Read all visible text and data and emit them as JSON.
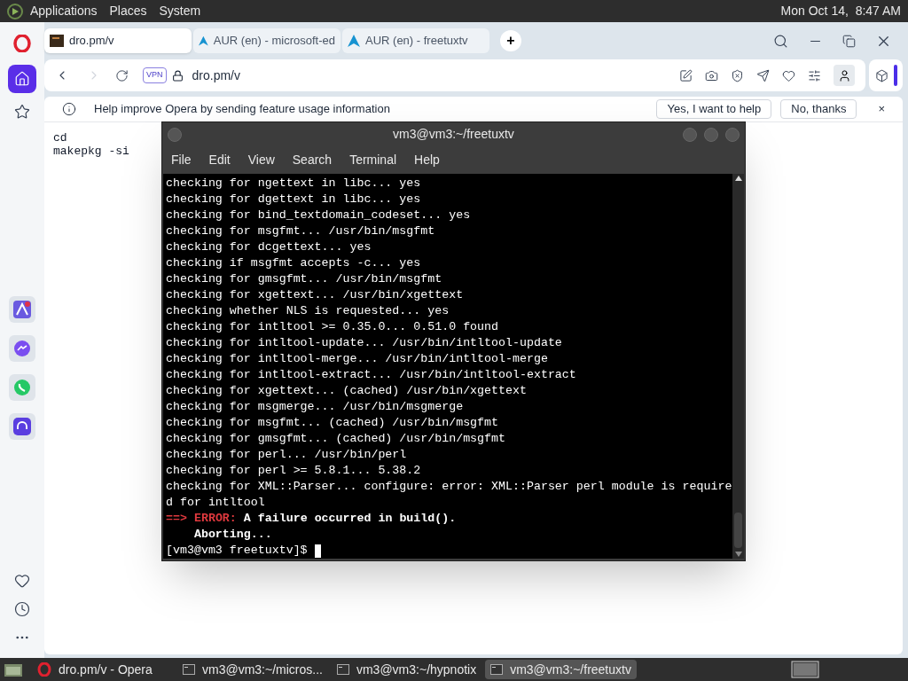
{
  "top_panel": {
    "menus": [
      "Applications",
      "Places",
      "System"
    ],
    "clock": "Mon Oct 14,  8:47 AM"
  },
  "browser": {
    "tabs": [
      {
        "label": "dro.pm/v",
        "selected": true,
        "kind": "page"
      },
      {
        "label": "AUR (en) - microsoft-ed",
        "selected": false,
        "kind": "arch"
      },
      {
        "label": "AUR (en) - freetuxtv",
        "selected": false,
        "kind": "arch"
      }
    ],
    "new_tab": "+",
    "address": {
      "vpn": "VPN",
      "url": "dro.pm/v"
    },
    "infobar": {
      "text": "Help improve Opera by sending feature usage information",
      "buttons": [
        "Yes, I want to help",
        "No, thanks"
      ],
      "close": "×"
    },
    "page_text": [
      "cd",
      "makepkg -si"
    ]
  },
  "terminal": {
    "title": "vm3@vm3:~/freetuxtv",
    "menus": [
      "File",
      "Edit",
      "View",
      "Search",
      "Terminal",
      "Help"
    ],
    "lines": [
      {
        "kind": "normal",
        "text": "checking for ngettext in libc... yes"
      },
      {
        "kind": "normal",
        "text": "checking for dgettext in libc... yes"
      },
      {
        "kind": "normal",
        "text": "checking for bind_textdomain_codeset... yes"
      },
      {
        "kind": "normal",
        "text": "checking for msgfmt... /usr/bin/msgfmt"
      },
      {
        "kind": "normal",
        "text": "checking for dcgettext... yes"
      },
      {
        "kind": "normal",
        "text": "checking if msgfmt accepts -c... yes"
      },
      {
        "kind": "normal",
        "text": "checking for gmsgfmt... /usr/bin/msgfmt"
      },
      {
        "kind": "normal",
        "text": "checking for xgettext... /usr/bin/xgettext"
      },
      {
        "kind": "normal",
        "text": "checking whether NLS is requested... yes"
      },
      {
        "kind": "normal",
        "text": "checking for intltool >= 0.35.0... 0.51.0 found"
      },
      {
        "kind": "normal",
        "text": "checking for intltool-update... /usr/bin/intltool-update"
      },
      {
        "kind": "normal",
        "text": "checking for intltool-merge... /usr/bin/intltool-merge"
      },
      {
        "kind": "normal",
        "text": "checking for intltool-extract... /usr/bin/intltool-extract"
      },
      {
        "kind": "normal",
        "text": "checking for xgettext... (cached) /usr/bin/xgettext"
      },
      {
        "kind": "normal",
        "text": "checking for msgmerge... /usr/bin/msgmerge"
      },
      {
        "kind": "normal",
        "text": "checking for msgfmt... (cached) /usr/bin/msgfmt"
      },
      {
        "kind": "normal",
        "text": "checking for gmsgfmt... (cached) /usr/bin/msgfmt"
      },
      {
        "kind": "normal",
        "text": "checking for perl... /usr/bin/perl"
      },
      {
        "kind": "normal",
        "text": "checking for perl >= 5.8.1... 5.38.2"
      },
      {
        "kind": "normal",
        "text": "checking for XML::Parser... configure: error: XML::Parser perl module is require"
      },
      {
        "kind": "normal",
        "text": "d for intltool"
      },
      {
        "kind": "error",
        "arrow": "==>",
        "label": "ERROR:",
        "text": "A failure occurred in build()."
      },
      {
        "kind": "bold",
        "text": "    Aborting..."
      },
      {
        "kind": "prompt",
        "text": "[vm3@vm3 freetuxtv]$"
      }
    ]
  },
  "taskbar": {
    "items": [
      {
        "label": "dro.pm/v - Opera",
        "kind": "browser",
        "selected": false
      },
      {
        "label": "vm3@vm3:~/micros...",
        "kind": "terminal",
        "selected": false
      },
      {
        "label": "vm3@vm3:~/hypnotix",
        "kind": "terminal",
        "selected": false
      },
      {
        "label": "vm3@vm3:~/freetuxtv",
        "kind": "terminal",
        "selected": true
      }
    ]
  }
}
